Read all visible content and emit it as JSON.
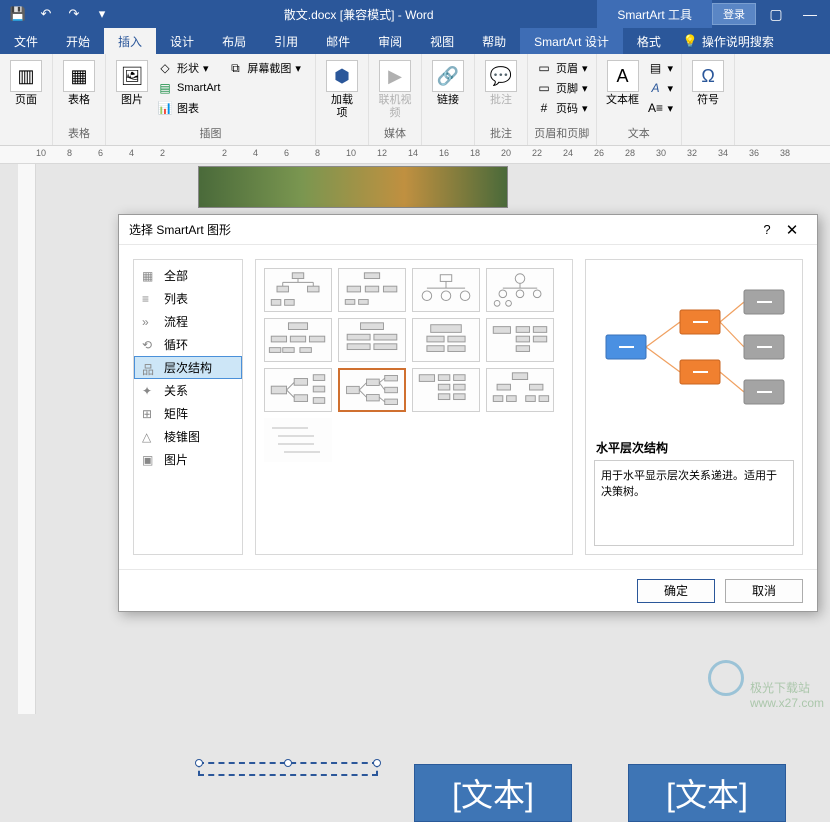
{
  "titlebar": {
    "doc_title": "散文.docx [兼容模式] - Word",
    "context_tool": "SmartArt 工具",
    "login": "登录"
  },
  "tabs": {
    "file": "文件",
    "home": "开始",
    "insert": "插入",
    "design": "设计",
    "layout": "布局",
    "references": "引用",
    "mailings": "邮件",
    "review": "审阅",
    "view": "视图",
    "help": "帮助",
    "smartart_design": "SmartArt 设计",
    "format": "格式",
    "tell_me": "操作说明搜索"
  },
  "ribbon": {
    "pages": {
      "group": "",
      "fengmian": "页面"
    },
    "tables": {
      "group": "表格",
      "label": "表格"
    },
    "illustrations": {
      "group": "插图",
      "pictures": "图片",
      "shapes": "形状",
      "smartart": "SmartArt",
      "chart": "图表",
      "screenshot": "屏幕截图"
    },
    "addins": {
      "group": "",
      "label": "加载\n项"
    },
    "media": {
      "group": "媒体",
      "online_video": "联机视频"
    },
    "links": {
      "group": "",
      "label": "链接"
    },
    "comments": {
      "group": "批注",
      "label": "批注"
    },
    "header_footer": {
      "group": "页眉和页脚",
      "header": "页眉",
      "footer": "页脚",
      "page_number": "页码"
    },
    "text": {
      "group": "文本",
      "textbox": "文本框"
    },
    "symbols": {
      "group": "",
      "symbol": "符号"
    }
  },
  "ruler": {
    "ticks": [
      "10",
      "8",
      "6",
      "4",
      "2",
      "",
      "2",
      "4",
      "6",
      "8",
      "10",
      "12",
      "14",
      "16",
      "18",
      "20",
      "22",
      "24",
      "26",
      "28",
      "30",
      "32",
      "34",
      "36",
      "38"
    ]
  },
  "dialog": {
    "title": "选择 SmartArt 图形",
    "sidebar": {
      "all": "全部",
      "list": "列表",
      "process": "流程",
      "cycle": "循环",
      "hierarchy": "层次结构",
      "relationship": "关系",
      "matrix": "矩阵",
      "pyramid": "棱锥图",
      "picture": "图片"
    },
    "preview": {
      "title": "水平层次结构",
      "description": "用于水平显示层次关系递进。适用于决策树。"
    },
    "ok": "确定",
    "cancel": "取消"
  },
  "smartart_placeholders": {
    "text1": "[文本]",
    "text2": "[文本]"
  },
  "watermark": {
    "brand": "极光下载站",
    "url": "www.x27.com"
  }
}
